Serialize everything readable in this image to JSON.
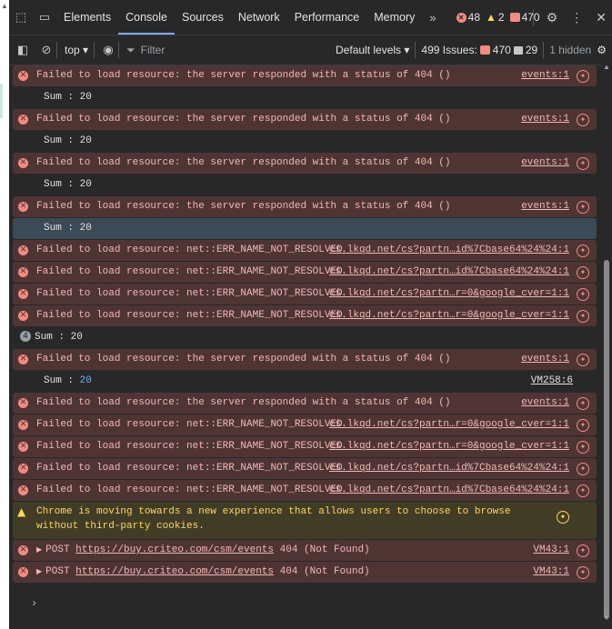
{
  "tabs": {
    "items": [
      "Elements",
      "Console",
      "Sources",
      "Network",
      "Performance",
      "Memory"
    ],
    "active": "Console",
    "more": "»"
  },
  "counters": {
    "errors": "48",
    "warnings": "2",
    "issues": "470"
  },
  "toolbar": {
    "context": "top ▾",
    "filter_placeholder": "Filter",
    "levels": "Default levels ▾",
    "issues_label": "499 Issues:",
    "issues_errors": "470",
    "issues_messages": "29",
    "hidden": "1 hidden"
  },
  "messages": {
    "e404": "Failed to load resource: the server responded with a status of 404 ()",
    "enr": "Failed to load resource: net::ERR_NAME_NOT_RESOLVED",
    "sum": "Sum : 20",
    "sum_label": "Sum : ",
    "sum_value": "20",
    "group_count": "4",
    "src_events": "events:1",
    "src_lkqd_id": "cs.lkqd.net/cs?partn…id%7Cbase64%24%24:1",
    "src_lkqd_r": "cs.lkqd.net/cs?partn…r=0&google_cver=1:1",
    "src_vm258": "VM258:6",
    "warning": "Chrome is moving towards a new experience that allows users to choose to browse without third-party cookies.",
    "post_method": "POST",
    "post_url": "https://buy.criteo.com/csm/events",
    "post_status": "404 (Not Found)",
    "src_vm43": "VM43:1"
  },
  "prompt": "›"
}
